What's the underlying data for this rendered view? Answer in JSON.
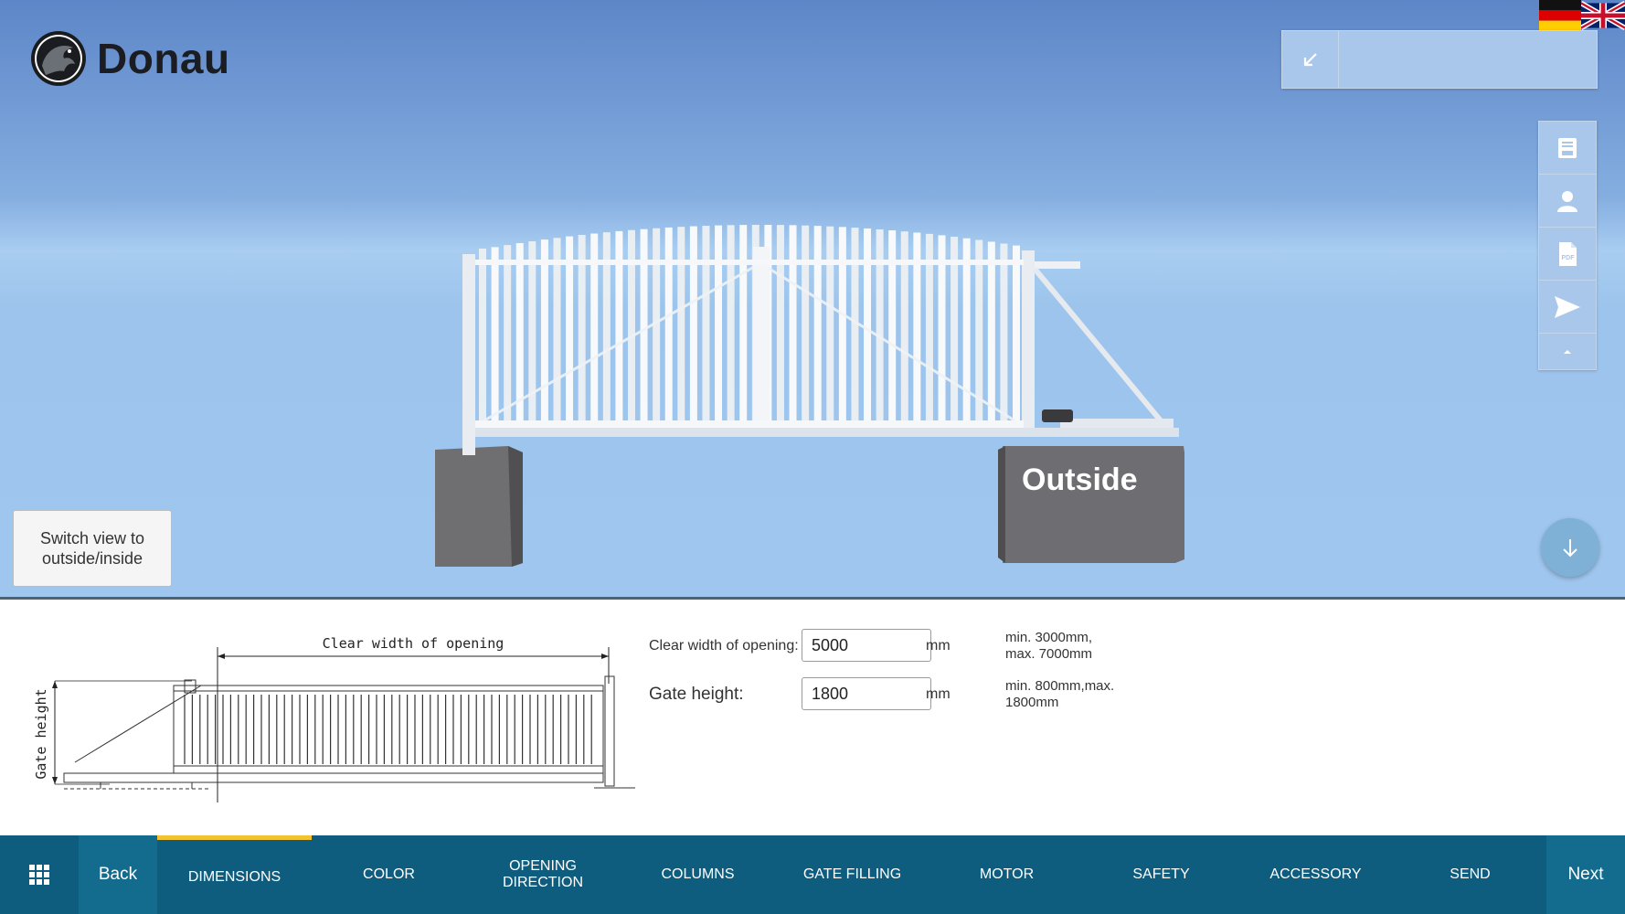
{
  "app": {
    "logo_text": "Donau"
  },
  "viewport": {
    "switch_view_label": "Switch view to\noutside/inside",
    "outside_label": "Outside"
  },
  "form": {
    "clear_width_label": "Clear width of opening:",
    "clear_width_value": "5000",
    "clear_width_unit": "mm",
    "clear_width_hint": "min. 3000mm,\nmax. 7000mm",
    "gate_height_label": "Gate height:",
    "gate_height_value": "1800",
    "gate_height_unit": "mm",
    "gate_height_hint": "min. 800mm,max.\n1800mm"
  },
  "diagram": {
    "clear_width_caption": "Clear width of opening",
    "gate_height_caption": "Gate height"
  },
  "nav": {
    "back_label": "Back",
    "next_label": "Next",
    "tabs": [
      {
        "label": "DIMENSIONS"
      },
      {
        "label": "COLOR"
      },
      {
        "label": "OPENING DIRECTION"
      },
      {
        "label": "COLUMNS"
      },
      {
        "label": "GATE FILLING"
      },
      {
        "label": "MOTOR"
      },
      {
        "label": "SAFETY"
      },
      {
        "label": "ACCESSORY"
      },
      {
        "label": "SEND"
      }
    ],
    "active_tab": "DIMENSIONS"
  },
  "icons": {
    "collapse": "arrow-bottom-left-icon",
    "save": "save-icon",
    "user": "user-icon",
    "pdf": "pdf-icon",
    "send": "send-icon",
    "collapse_up": "caret-up-icon",
    "scroll_down": "arrow-down-icon",
    "menu": "grid-menu-icon"
  },
  "colors": {
    "nav_bg": "#0e5c7e",
    "nav_highlight": "#136b8e",
    "active_tab_indicator": "#f1c232"
  }
}
